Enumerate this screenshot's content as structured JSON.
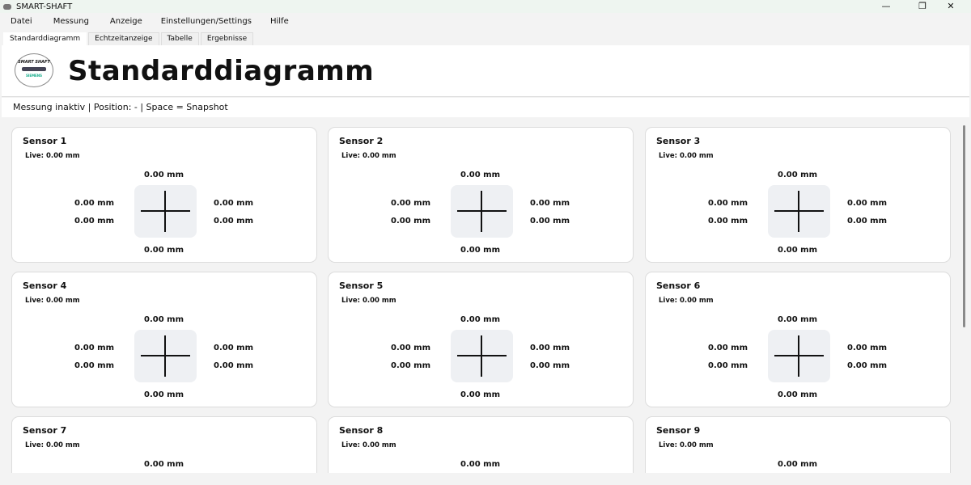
{
  "window": {
    "title": "SMART-SHAFT",
    "controls": {
      "minimize": "—",
      "maximize": "❐",
      "close": "✕"
    }
  },
  "menu": [
    "Datei",
    "Messung",
    "Anzeige",
    "Einstellungen/Settings",
    "Hilfe"
  ],
  "tabs": [
    "Standarddiagramm",
    "Echtzeitanzeige",
    "Tabelle",
    "Ergebnisse"
  ],
  "active_tab": 0,
  "header": {
    "title": "Standarddiagramm",
    "logo_text": "SMART SHAFT",
    "logo_sub": "SIEMENS"
  },
  "status": "Messung inaktiv | Position: - | Space = Snapshot",
  "sensors": [
    {
      "name": "Sensor 1",
      "live": "Live: 0.00 mm",
      "top": "0.00 mm",
      "left1": "0.00 mm",
      "left2": "0.00 mm",
      "right1": "0.00 mm",
      "right2": "0.00 mm",
      "bottom": "0.00 mm"
    },
    {
      "name": "Sensor 2",
      "live": "Live: 0.00 mm",
      "top": "0.00 mm",
      "left1": "0.00 mm",
      "left2": "0.00 mm",
      "right1": "0.00 mm",
      "right2": "0.00 mm",
      "bottom": "0.00 mm"
    },
    {
      "name": "Sensor 3",
      "live": "Live: 0.00 mm",
      "top": "0.00 mm",
      "left1": "0.00 mm",
      "left2": "0.00 mm",
      "right1": "0.00 mm",
      "right2": "0.00 mm",
      "bottom": "0.00 mm"
    },
    {
      "name": "Sensor 4",
      "live": "Live: 0.00 mm",
      "top": "0.00 mm",
      "left1": "0.00 mm",
      "left2": "0.00 mm",
      "right1": "0.00 mm",
      "right2": "0.00 mm",
      "bottom": "0.00 mm"
    },
    {
      "name": "Sensor 5",
      "live": "Live: 0.00 mm",
      "top": "0.00 mm",
      "left1": "0.00 mm",
      "left2": "0.00 mm",
      "right1": "0.00 mm",
      "right2": "0.00 mm",
      "bottom": "0.00 mm"
    },
    {
      "name": "Sensor 6",
      "live": "Live: 0.00 mm",
      "top": "0.00 mm",
      "left1": "0.00 mm",
      "left2": "0.00 mm",
      "right1": "0.00 mm",
      "right2": "0.00 mm",
      "bottom": "0.00 mm"
    },
    {
      "name": "Sensor 7",
      "live": "Live: 0.00 mm",
      "top": "0.00 mm"
    },
    {
      "name": "Sensor 8",
      "live": "Live: 0.00 mm",
      "top": "0.00 mm"
    },
    {
      "name": "Sensor 9",
      "live": "Live: 0.00 mm",
      "top": "0.00 mm"
    }
  ]
}
